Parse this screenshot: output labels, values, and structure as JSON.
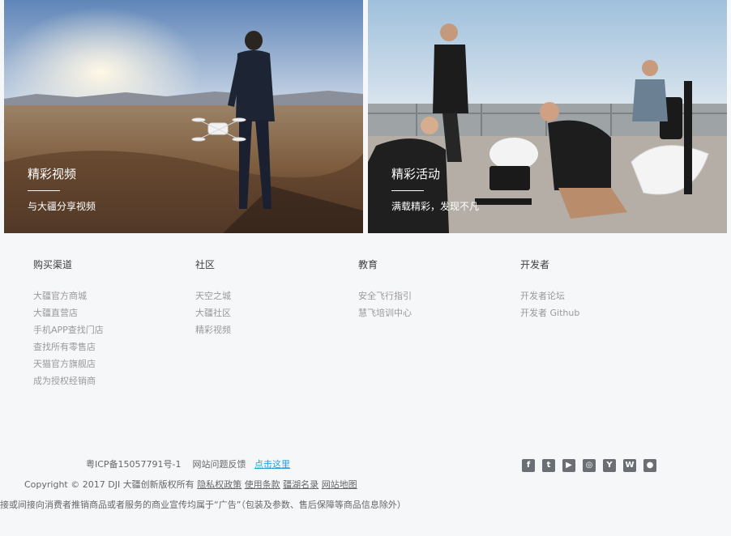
{
  "banners": [
    {
      "title": "精彩视频",
      "subtitle": "与大疆分享视频"
    },
    {
      "title": "精彩活动",
      "subtitle": "满载精彩，发现不凡"
    }
  ],
  "footer": {
    "columns": [
      {
        "heading": "购买渠道",
        "links": [
          "大疆官方商城",
          "大疆直营店",
          "手机APP查找门店",
          "查找所有零售店",
          "天猫官方旗舰店",
          "成为授权经销商"
        ]
      },
      {
        "heading": "社区",
        "links": [
          "天空之城",
          "大疆社区",
          "精彩视频"
        ]
      },
      {
        "heading": "教育",
        "links": [
          "安全飞行指引",
          "慧飞培训中心"
        ]
      },
      {
        "heading": "开发者",
        "links": [
          "开发者论坛",
          "开发者 Github"
        ]
      }
    ],
    "icp": "粤ICP备15057791号-1",
    "feedback_label": "网站问题反馈",
    "feedback_link": "点击这里",
    "copyright": "Copyright © 2017 DJI 大疆创新版权所有",
    "legal_links": [
      "隐私权政策",
      "使用条款",
      "疆湖名录",
      "网站地图"
    ],
    "ad_notice": "接或间接向消费者推销商品或者服务的商业宣传均属于“广告”（包装及参数、售后保障等商品信息除外）",
    "social_icons": [
      "facebook-icon",
      "twitter-icon",
      "youtube-icon",
      "instagram-icon",
      "youku-icon",
      "weibo-icon",
      "wechat-icon"
    ]
  }
}
